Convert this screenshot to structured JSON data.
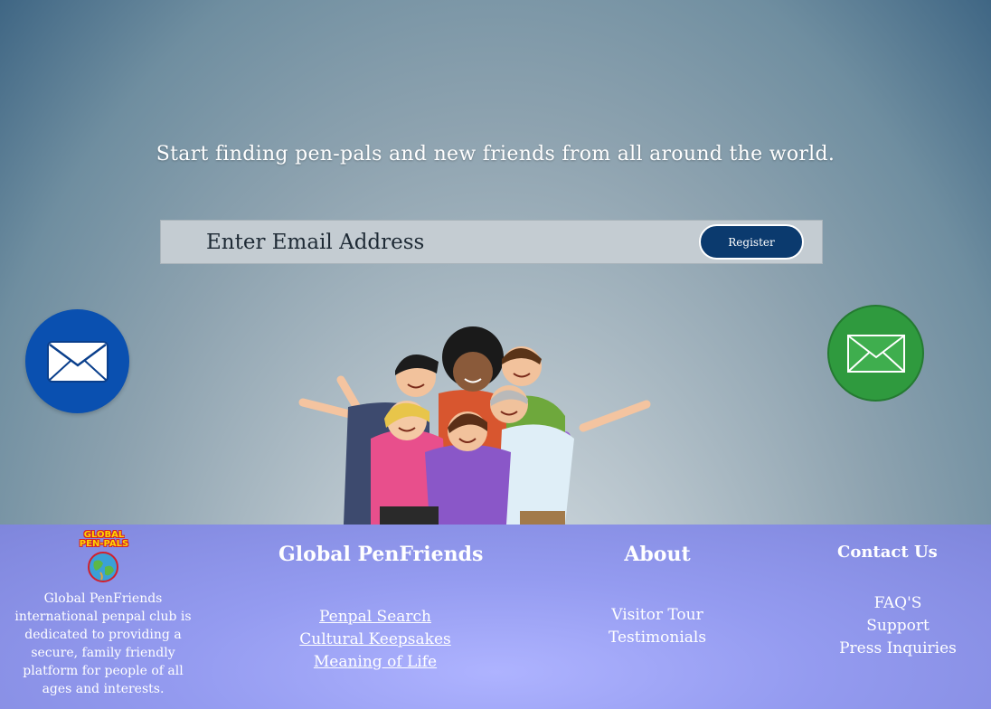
{
  "hero": {
    "tagline": "Start finding pen-pals and new friends from all around the world.",
    "email_placeholder": "Enter Email Address",
    "register_label": "Register",
    "left_icon": "envelope-icon",
    "right_icon": "envelope-icon",
    "left_icon_color": "#0a50b0",
    "right_icon_color": "#2f9a3e"
  },
  "footer": {
    "logo": {
      "line1": "GLOBAL",
      "line2": "PEN-PALS"
    },
    "about_text": "Global PenFriends international penpal club is dedicated to providing a secure, family friendly platform for people of all ages and interests.",
    "col1": {
      "heading": "Global PenFriends",
      "links": [
        "Penpal Search",
        "Cultural Keepsakes",
        "Meaning of Life"
      ]
    },
    "col2": {
      "heading": "About",
      "links": [
        "Visitor Tour",
        "Testimonials"
      ]
    },
    "col3": {
      "heading": "Contact Us",
      "links": [
        "FAQ'S",
        "Support",
        "Press Inquiries"
      ]
    }
  },
  "colors": {
    "register_bg": "#0b3a6e",
    "footer_bg": "#949bf0"
  }
}
